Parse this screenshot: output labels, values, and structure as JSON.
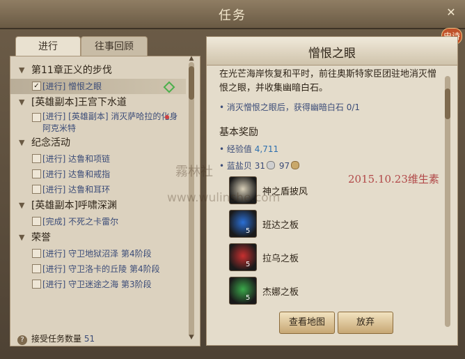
{
  "window": {
    "title": "任务",
    "corner_badge": "史诗"
  },
  "tabs": [
    {
      "label": "进行"
    },
    {
      "label": "往事回顾"
    }
  ],
  "quest_list": {
    "groups": [
      {
        "title": "第11章正义的步伐",
        "quests": [
          {
            "label": "[进行] 憎恨之眼",
            "checked": true
          }
        ]
      },
      {
        "title": "[英雄副本]王宫下水道",
        "quests": [
          {
            "label": "[进行] [英雄副本] 消灭萨哈拉的化身阿克米特",
            "checked": false
          }
        ]
      },
      {
        "title": "纪念活动",
        "quests": [
          {
            "label": "[进行] 达鲁和项链",
            "checked": false
          },
          {
            "label": "[进行] 达鲁和戒指",
            "checked": false
          },
          {
            "label": "[进行] 达鲁和耳环",
            "checked": false
          }
        ]
      },
      {
        "title": "[英雄副本]呼啸深渊",
        "quests": [
          {
            "label": "[完成] 不死之卡雷尔",
            "checked": false
          }
        ]
      },
      {
        "title": "荣誉",
        "quests": [
          {
            "label": "[进行] 守卫地狱沼泽 第4阶段",
            "checked": false
          },
          {
            "label": "[进行] 守卫洛卡的丘陵 第4阶段",
            "checked": false
          },
          {
            "label": "[进行] 守卫迷途之海 第3阶段",
            "checked": false
          }
        ]
      }
    ]
  },
  "footer": {
    "label": "接受任务数量",
    "count": "51"
  },
  "detail": {
    "title": "憎恨之眼",
    "description": "在光芒海岸恢复和平时，前往奥斯特家臣团驻地消灭憎恨之眼，并收集幽暗白石。",
    "objective": "消灭憎恨之眼后，获得幽暗白石 0/1",
    "reward_title": "基本奖励",
    "exp_label": "经验值",
    "exp_value": "4,711",
    "money_label": "蓝盐贝",
    "money_a": "31",
    "money_b": "97",
    "items": [
      {
        "name": "神之盾披风",
        "count": "",
        "icon": "cloak-icon",
        "color": "#d8cfb8"
      },
      {
        "name": "班达之板",
        "count": "5",
        "icon": "blue-tablet-icon",
        "color": "#2a6fd6"
      },
      {
        "name": "拉乌之板",
        "count": "5",
        "icon": "red-tablet-icon",
        "color": "#c83030"
      },
      {
        "name": "杰娜之板",
        "count": "5",
        "icon": "green-tablet-icon",
        "color": "#3aa84a"
      }
    ],
    "view_map_label": "查看地图",
    "abandon_label": "放弃"
  },
  "watermark": {
    "text": "霧林社",
    "url": "www.wulinshe.com",
    "date": "2015.10.23维生素"
  }
}
